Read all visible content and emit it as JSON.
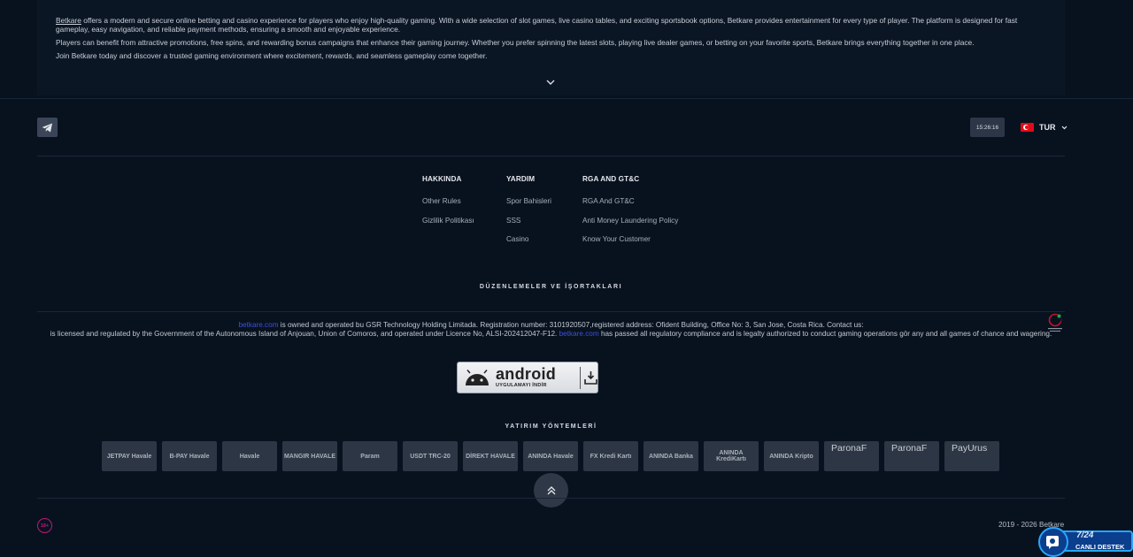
{
  "about": {
    "brand_link": "Betkare",
    "p1_rest": " offers a modern and secure online betting and casino experience for players who enjoy high-quality gaming. With a wide selection of slot games, live casino tables, and exciting sportsbook options, Betkare provides entertainment for every type of player. The platform is designed for fast gameplay, easy navigation, and reliable payment methods, ensuring a smooth and enjoyable experience.",
    "p2": "Players can benefit from attractive promotions, free spins, and rewarding bonus campaigns that enhance their gaming journey. Whether you prefer spinning the latest slots, playing live dealer games, or betting on your favorite sports, Betkare brings everything together in one place.",
    "p3": "Join Betkare today and discover a trusted gaming environment where excitement, rewards, and seamless gameplay come together."
  },
  "clock": "15:26:16",
  "language": {
    "code": "TUR"
  },
  "columns": [
    {
      "title": "HAKKINDA",
      "links": [
        "Other Rules",
        "Gizlilik Politikası"
      ]
    },
    {
      "title": "YARDIM",
      "links": [
        "Spor Bahisleri",
        "SSS",
        "Casino"
      ]
    },
    {
      "title": "RGA AND GT&C",
      "links": [
        "RGA And GT&C",
        "Anti Money Laundering Policy",
        "Know Your Customer"
      ]
    }
  ],
  "partners_title": "DÜZENLEMELER VE İŞORTAKLARI",
  "license": {
    "domain1": "betkare.com",
    "line1_rest": " is owned and operated bu GSR Technology Holding Limitada. Registration number: 3101920507,registered address: Ofident Building, Office No: 3, San Jose, Costa Rica. Contact us:",
    "line2_start": "is licensed and regulated by the Government of the Autonomous Island of Anjouan, Union of Comoros, and operated under Licence No, ALSI-202412047-F12. ",
    "domain2": "betkare.com",
    "line2_rest": " has passed all regulatory compliance and is legalty authorized to conduct gaming operations gör any and all games of chance and wagering."
  },
  "android": {
    "title": "android",
    "subtitle": "UYGULAMAYI İNDİR"
  },
  "payments_title": "YATIRIM YÖNTEMLERİ",
  "payments": [
    {
      "label": "JETPAY Havale",
      "broken": false
    },
    {
      "label": "B-PAY Havale",
      "broken": false
    },
    {
      "label": "Havale",
      "broken": false
    },
    {
      "label": "MANGIR HAVALE",
      "broken": false
    },
    {
      "label": "Param",
      "broken": false
    },
    {
      "label": "USDT TRC-20",
      "broken": false
    },
    {
      "label": "DİREKT HAVALE",
      "broken": false
    },
    {
      "label": "ANINDA Havale",
      "broken": false
    },
    {
      "label": "FX Kredi Kartı",
      "broken": false
    },
    {
      "label": "ANINDA Banka",
      "broken": false
    },
    {
      "label": "ANINDA KrediKartı",
      "broken": false
    },
    {
      "label": "ANINDA Kripto",
      "broken": false
    },
    {
      "label": "ParonaF",
      "broken": true
    },
    {
      "label": "ParonaF",
      "broken": true
    },
    {
      "label": "PayUrus",
      "broken": true
    }
  ],
  "age_badge": "18+",
  "copyright": "2019 - 2026 Betkare",
  "support": {
    "line1": "7/24",
    "line2": "CANLI DESTEK"
  },
  "colors": {
    "background": "#08121f",
    "link_blue": "#3b4fe0",
    "age_magenta": "#c2167a",
    "support_blue": "#27a7ff"
  }
}
